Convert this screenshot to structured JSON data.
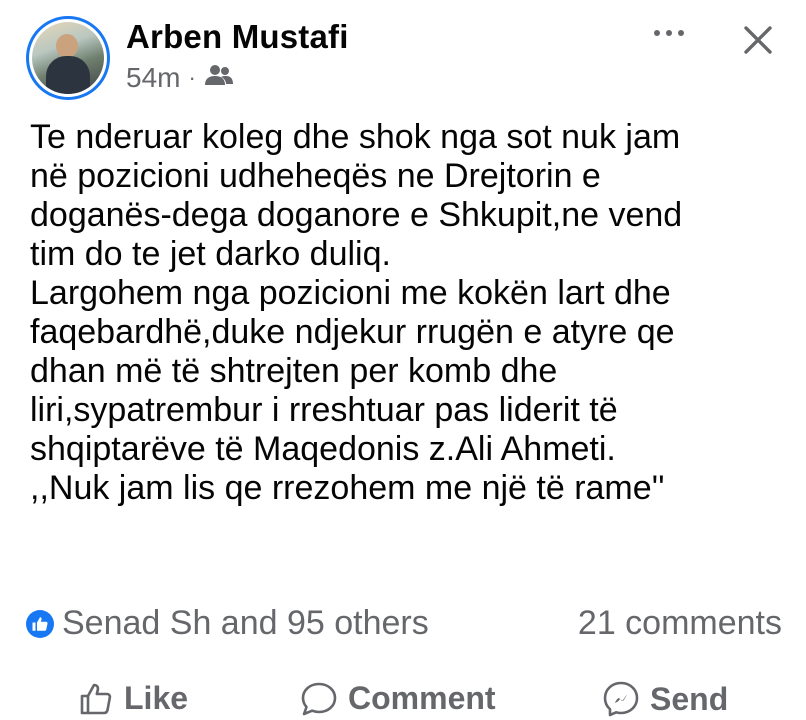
{
  "post": {
    "author": "Arben Mustafi",
    "time": "54m",
    "separator": "·",
    "audience_icon": "friends-icon",
    "body_lines": [
      "Te nderuar koleg dhe shok nga sot nuk jam",
      "në pozicioni udheheqës ne Drejtorin e",
      "doganës-dega doganore e Shkupit,ne vend",
      "tim do te jet darko duliq.",
      "Largohem nga pozicioni me kokën lart dhe",
      "faqebardhë,duke ndjekur rrugën e atyre qe",
      "dhan më të shtrejten per komb dhe",
      "liri,sypatrembur i rreshtuar pas liderit të",
      "shqiptarëve të Maqedonis z.Ali Ahmeti.",
      ",,Nuk jam lis qe rrezohem me një të rame''"
    ]
  },
  "reactions": {
    "summary": "Senad Sh and 95 others",
    "comments": "21 comments"
  },
  "actions": {
    "like": "Like",
    "comment": "Comment",
    "send": "Send"
  },
  "colors": {
    "brand": "#1877f2",
    "secondary_text": "#65676b",
    "primary_text": "#050505"
  }
}
